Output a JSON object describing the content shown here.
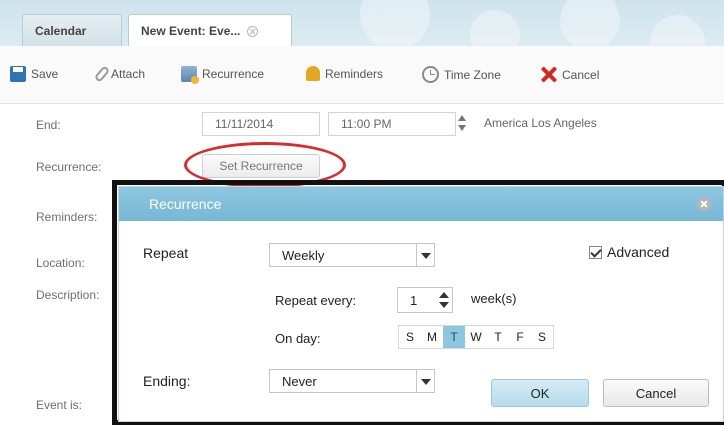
{
  "tabs": [
    {
      "label": "Calendar"
    },
    {
      "label": "New Event: Eve..."
    }
  ],
  "toolbar": {
    "save": "Save",
    "attach": "Attach",
    "recurrence": "Recurrence",
    "reminders": "Reminders",
    "time_zone": "Time Zone",
    "cancel": "Cancel"
  },
  "form": {
    "end_label": "End:",
    "end_date": "11/11/2014",
    "end_time": "11:00 PM",
    "timezone": "America Los Angeles",
    "recurrence_label": "Recurrence:",
    "set_recurrence": "Set Recurrence",
    "reminders_label": "Reminders:",
    "location_label": "Location:",
    "description_label": "Description:",
    "event_is_label": "Event is:"
  },
  "dialog": {
    "title": "Recurrence",
    "repeat_label": "Repeat",
    "repeat_value": "Weekly",
    "advanced_label": "Advanced",
    "advanced_checked": true,
    "repeat_every_label": "Repeat every:",
    "repeat_every_value": "1",
    "repeat_every_unit": "week(s)",
    "on_day_label": "On day:",
    "days": [
      "S",
      "M",
      "T",
      "W",
      "T",
      "F",
      "S"
    ],
    "selected_day_index": 2,
    "ending_label": "Ending:",
    "ending_value": "Never",
    "ok": "OK",
    "cancel": "Cancel"
  },
  "colors": {
    "dialog_header": "#8fc7e0",
    "selected_day": "#8cc6df",
    "highlight_ellipse": "#d92b2b",
    "cancel_icon": "#d7261b"
  }
}
